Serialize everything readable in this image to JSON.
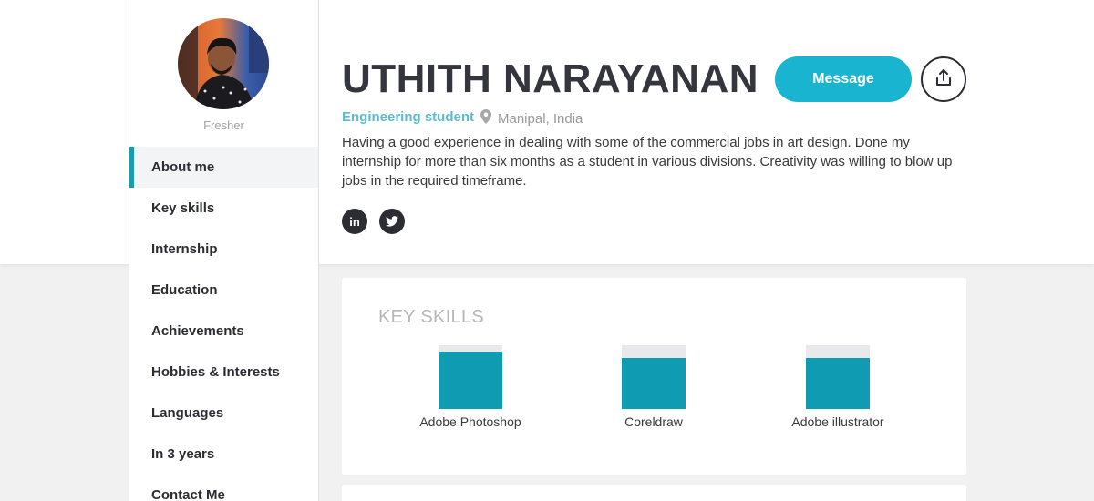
{
  "profile": {
    "name": "UTHITH NARAYANAN",
    "role": "Engineering student",
    "location": "Manipal, India",
    "status": "Fresher",
    "bio": "Having a good experience in dealing with some of the commercial jobs in art design. Done my internship for more than six months as a student in various divisions. Creativity was willing to blow up jobs in the required timeframe."
  },
  "actions": {
    "message_label": "Message"
  },
  "social": [
    {
      "icon": "linkedin-icon",
      "glyph": "in"
    },
    {
      "icon": "twitter-icon"
    }
  ],
  "nav": {
    "items": [
      {
        "label": "About me",
        "active": true
      },
      {
        "label": "Key skills"
      },
      {
        "label": "Internship"
      },
      {
        "label": "Education"
      },
      {
        "label": "Achievements"
      },
      {
        "label": "Hobbies & Interests"
      },
      {
        "label": "Languages"
      },
      {
        "label": "In 3 years"
      },
      {
        "label": "Contact Me"
      }
    ]
  },
  "skills": {
    "title": "KEY SKILLS",
    "items": [
      {
        "label": "Adobe Photoshop",
        "level": 0.9
      },
      {
        "label": "Coreldraw",
        "level": 0.8
      },
      {
        "label": "Adobe illustrator",
        "level": 0.8
      }
    ]
  },
  "colors": {
    "accent": "#19b4cf",
    "skill_fill": "#0f9bb1",
    "role_text": "#5bbccf",
    "dark": "#2c2c33"
  }
}
